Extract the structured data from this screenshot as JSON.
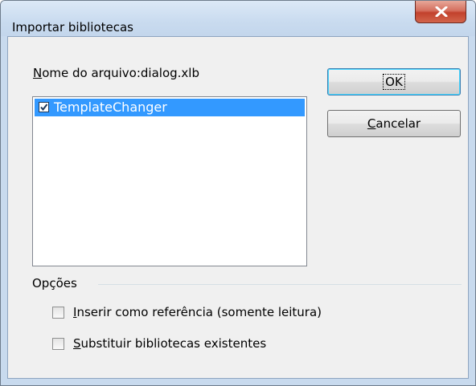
{
  "window": {
    "title": "Importar bibliotecas"
  },
  "file": {
    "label_prefix": "N",
    "label_rest": "ome do arquivo:",
    "filename": "dialog.xlb"
  },
  "libraries": [
    {
      "label": "TemplateChanger",
      "checked": true,
      "selected": true
    }
  ],
  "buttons": {
    "ok_label": "OK",
    "cancel_prefix": "C",
    "cancel_rest": "ancelar"
  },
  "options": {
    "group_label": "Opções",
    "insert_prefix": "I",
    "insert_rest": "nserir como referência (somente leitura)",
    "insert_checked": false,
    "replace_prefix": "S",
    "replace_rest": "ubstituir bibliotecas existentes",
    "replace_checked": false
  },
  "colors": {
    "selection": "#3399ff",
    "close_button": "#c2412c"
  }
}
